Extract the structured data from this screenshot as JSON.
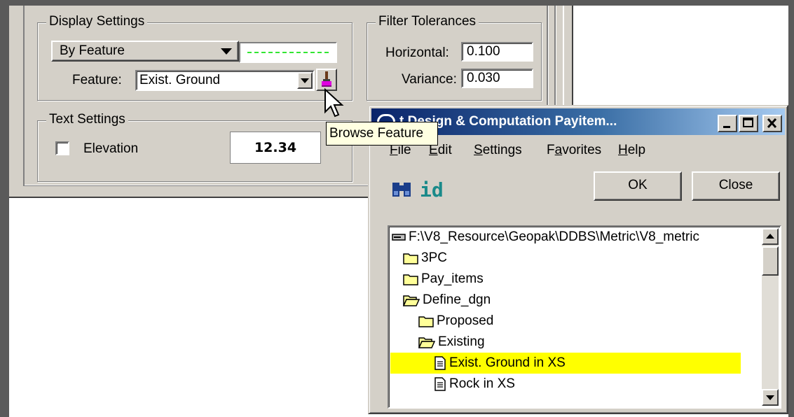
{
  "settings": {
    "display_group_title": "Display Settings",
    "mode_dropdown_value": "By Feature",
    "feature_label": "Feature:",
    "feature_value": "Exist. Ground",
    "text_group_title": "Text Settings",
    "elevation_label": "Elevation",
    "elevation_checked": false,
    "preview_text": "12.34",
    "line_preview_color": "#33e633"
  },
  "filter": {
    "group_title": "Filter Tolerances",
    "horizontal_label": "Horizontal:",
    "horizontal_value": "0.100",
    "variance_label": "Variance:",
    "variance_value": "0.030"
  },
  "tooltip": {
    "text": "Browse Feature"
  },
  "dialog": {
    "title": "Project Design & Computation Payitem...",
    "title_visible": "t Design & Computation Payitem...",
    "menu": [
      {
        "ul": "F",
        "rest": "ile"
      },
      {
        "ul": "E",
        "rest": "dit"
      },
      {
        "ul": "S",
        "rest": "ettings"
      },
      {
        "pre": "F",
        "ul": "a",
        "rest": "vorites"
      },
      {
        "ul": "H",
        "rest": "elp"
      }
    ],
    "ok_label": "OK",
    "close_label": "Close",
    "tree_root": "F:\\V8_Resource\\Geopak\\DDBS\\Metric\\V8_metric",
    "tree": [
      {
        "label": "3PC",
        "icon": "folder-icon"
      },
      {
        "label": "Pay_items",
        "icon": "folder-icon"
      },
      {
        "label": "Define_dgn",
        "icon": "folder-open-icon"
      },
      {
        "label": "Proposed",
        "icon": "folder-icon"
      },
      {
        "label": "Existing",
        "icon": "folder-open-icon"
      },
      {
        "label": "Exist. Ground in XS",
        "icon": "document-icon",
        "selected": true
      },
      {
        "label": "Rock in XS",
        "icon": "document-icon"
      }
    ]
  },
  "colors": {
    "window_face": "#d4d0c8",
    "title_bar_start": "#0a246a",
    "title_bar_end": "#a6caf0",
    "selection": "#ffff00",
    "tooltip_bg": "#ffffe1"
  }
}
